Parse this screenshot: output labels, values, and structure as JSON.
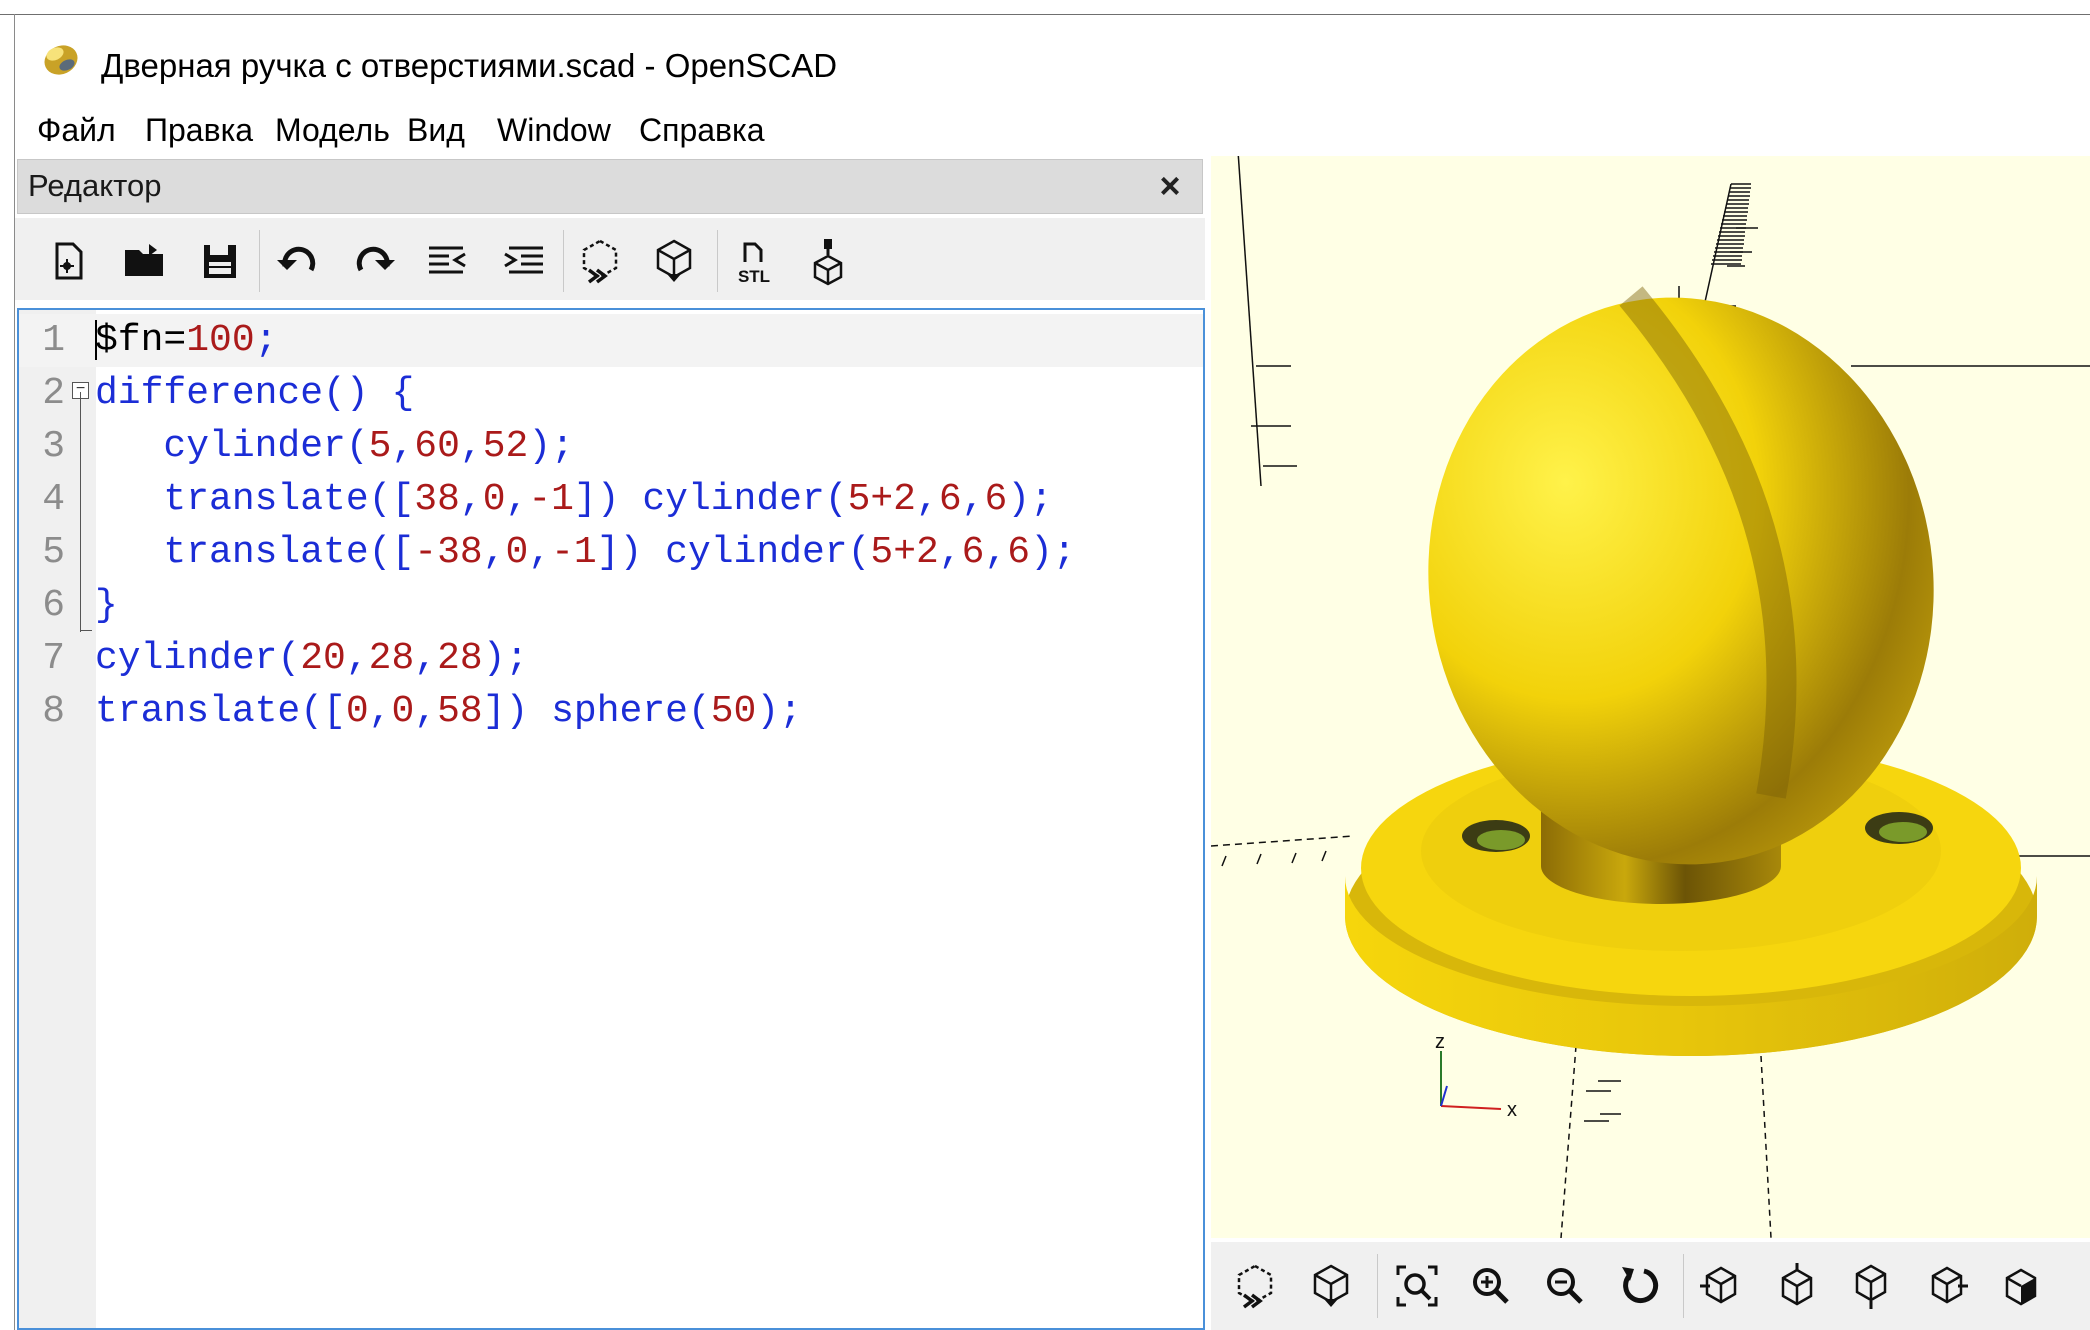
{
  "window": {
    "title": "Дверная ручка с отверстиями.scad - OpenSCAD",
    "icon": "openscad-logo"
  },
  "menu": [
    "Файл",
    "Правка",
    "Модель",
    "Вид",
    "Window",
    "Справка"
  ],
  "editor": {
    "title": "Редактор",
    "close_glyph": "×",
    "toolbar": [
      "new-file-icon",
      "open-file-icon",
      "save-file-icon",
      "undo-icon",
      "redo-icon",
      "unindent-icon",
      "indent-icon",
      "preview-icon",
      "render-icon",
      "export-stl-icon",
      "send-to-print-icon"
    ],
    "lines": [
      {
        "n": "1",
        "tokens": [
          [
            "black",
            "$fn="
          ],
          [
            "red",
            "100"
          ],
          [
            "blue",
            ";"
          ]
        ]
      },
      {
        "n": "2",
        "tokens": [
          [
            "blue",
            "difference() {"
          ]
        ]
      },
      {
        "n": "3",
        "tokens": [
          [
            "blue",
            "   cylinder("
          ],
          [
            "red",
            "5"
          ],
          [
            "blue",
            ","
          ],
          [
            "red",
            "60"
          ],
          [
            "blue",
            ","
          ],
          [
            "red",
            "52"
          ],
          [
            "blue",
            ");"
          ]
        ]
      },
      {
        "n": "4",
        "tokens": [
          [
            "blue",
            "   translate(["
          ],
          [
            "red",
            "38"
          ],
          [
            "blue",
            ","
          ],
          [
            "red",
            "0"
          ],
          [
            "blue",
            ","
          ],
          [
            "red",
            "-1"
          ],
          [
            "blue",
            "]) cylinder("
          ],
          [
            "red",
            "5+2"
          ],
          [
            "blue",
            ","
          ],
          [
            "red",
            "6"
          ],
          [
            "blue",
            ","
          ],
          [
            "red",
            "6"
          ],
          [
            "blue",
            ");"
          ]
        ]
      },
      {
        "n": "5",
        "tokens": [
          [
            "blue",
            "   translate(["
          ],
          [
            "red",
            "-38"
          ],
          [
            "blue",
            ","
          ],
          [
            "red",
            "0"
          ],
          [
            "blue",
            ","
          ],
          [
            "red",
            "-1"
          ],
          [
            "blue",
            "]) cylinder("
          ],
          [
            "red",
            "5+2"
          ],
          [
            "blue",
            ","
          ],
          [
            "red",
            "6"
          ],
          [
            "blue",
            ","
          ],
          [
            "red",
            "6"
          ],
          [
            "blue",
            ");"
          ]
        ]
      },
      {
        "n": "6",
        "tokens": [
          [
            "blue",
            "}"
          ]
        ]
      },
      {
        "n": "7",
        "tokens": [
          [
            "blue",
            "cylinder("
          ],
          [
            "red",
            "20"
          ],
          [
            "blue",
            ","
          ],
          [
            "red",
            "28"
          ],
          [
            "blue",
            ","
          ],
          [
            "red",
            "28"
          ],
          [
            "blue",
            ");"
          ]
        ]
      },
      {
        "n": "8",
        "tokens": [
          [
            "blue",
            "translate(["
          ],
          [
            "red",
            "0"
          ],
          [
            "blue",
            ","
          ],
          [
            "red",
            "0"
          ],
          [
            "blue",
            ","
          ],
          [
            "red",
            "58"
          ],
          [
            "blue",
            "]) sphere("
          ],
          [
            "red",
            "50"
          ],
          [
            "blue",
            ");"
          ]
        ]
      }
    ]
  },
  "viewport": {
    "background": "#ffffe5",
    "model_color": "#f5d40e",
    "axis_labels": {
      "z": "z",
      "x": "x"
    }
  },
  "view_toolbar": [
    "preview-icon",
    "render-icon",
    "view-all-icon",
    "zoom-in-icon",
    "zoom-out-icon",
    "reset-view-icon",
    "view-right-icon",
    "view-top-icon",
    "view-bottom-icon",
    "view-left-icon",
    "view-front-icon"
  ],
  "colors": {
    "keyword_blue": "#1b2dd6",
    "number_red": "#aa1a1a",
    "editor_focus_border": "#4a90d9"
  }
}
